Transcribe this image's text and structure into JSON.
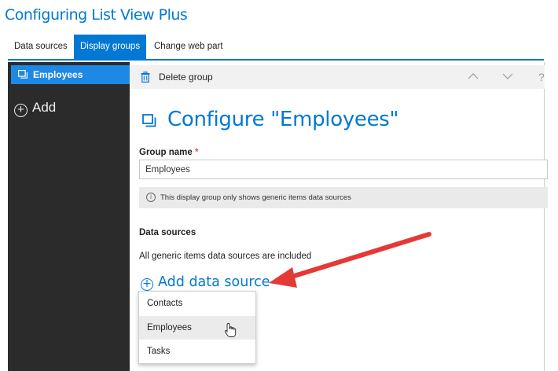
{
  "app": {
    "title": "Configuring List View Plus"
  },
  "tabs": [
    {
      "label": "Data sources",
      "active": false
    },
    {
      "label": "Display groups",
      "active": true
    },
    {
      "label": "Change web part",
      "active": false
    }
  ],
  "sidebar": {
    "items": [
      {
        "label": "Employees",
        "icon": "group-icon"
      }
    ],
    "add_label": "Add"
  },
  "toolbar": {
    "delete_label": "Delete group",
    "help_symbol": "?"
  },
  "main": {
    "title": "Configure \"Employees\"",
    "group_name_label": "Group name",
    "required_mark": "*",
    "group_name_value": "Employees",
    "info_symbol": "i",
    "info_text": "This display group only shows generic items data sources",
    "data_sources_label": "Data sources",
    "data_sources_desc": "All generic items data sources are included",
    "add_data_source_label": "Add data source"
  },
  "dropdown": {
    "options": [
      "Contacts",
      "Employees",
      "Tasks"
    ],
    "hovered": "Employees"
  },
  "colors": {
    "accent": "#0078d4",
    "sidebar_bg": "#2b2b2b",
    "arrow": "#e53935"
  }
}
